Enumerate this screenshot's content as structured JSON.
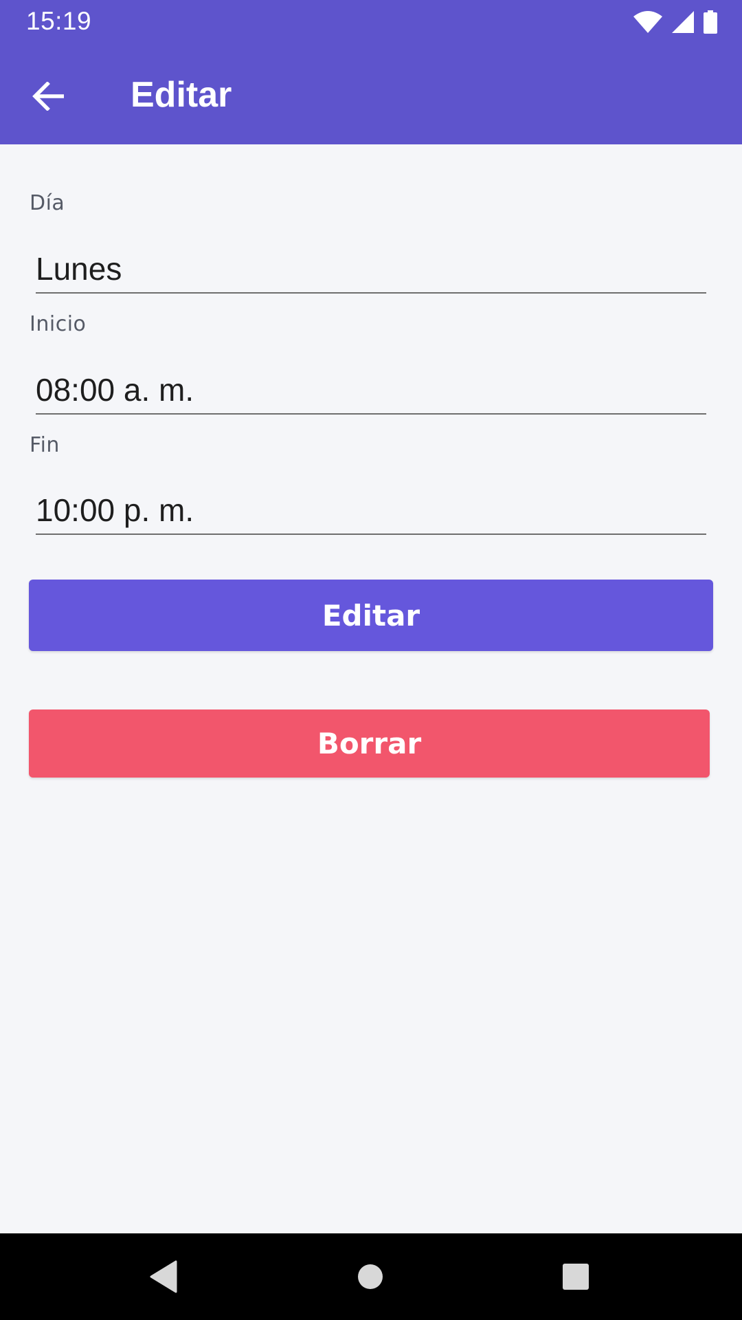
{
  "status_bar": {
    "time": "15:19",
    "icons": [
      "wifi-icon",
      "signal-icon",
      "battery-icon"
    ]
  },
  "app_bar": {
    "title": "Editar",
    "back_icon": "arrow-left-icon"
  },
  "form": {
    "day": {
      "label": "Día",
      "value": "Lunes"
    },
    "start": {
      "label": "Inicio",
      "value": "08:00 a. m."
    },
    "end": {
      "label": "Fin",
      "value": "10:00 p. m."
    }
  },
  "actions": {
    "edit_label": "Editar",
    "delete_label": "Borrar"
  },
  "nav_bar": {
    "icons": [
      "back-triangle-icon",
      "home-circle-icon",
      "recents-square-icon"
    ]
  },
  "colors": {
    "primary": "#5e54cc",
    "edit_button": "#6557dc",
    "delete_button": "#f2566c",
    "background": "#f5f6f9"
  }
}
